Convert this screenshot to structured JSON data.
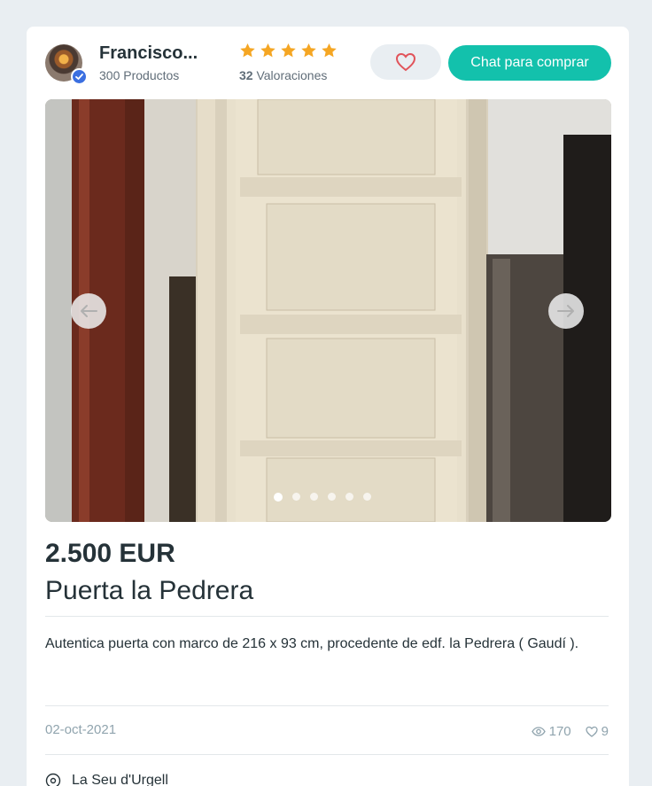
{
  "seller": {
    "name": "Francisco...",
    "products": "300 Productos",
    "rating_stars": 5,
    "ratings_count": "32",
    "ratings_label": "Valoraciones"
  },
  "actions": {
    "chat_label": "Chat para comprar"
  },
  "carousel": {
    "image_count": 6,
    "active_index": 0
  },
  "product": {
    "price": "2.500 EUR",
    "title": "Puerta la Pedrera",
    "description": "Autentica puerta con marco de 216 x 93 cm, procedente de edf. la Pedrera ( Gaudí ).",
    "date": "02-oct-2021",
    "views": "170",
    "favorites": "9",
    "location": "La Seu d'Urgell"
  },
  "colors": {
    "accent": "#13c1ac",
    "star": "#f5a623",
    "heart": "#e1535a",
    "verified": "#3b6fe0"
  }
}
